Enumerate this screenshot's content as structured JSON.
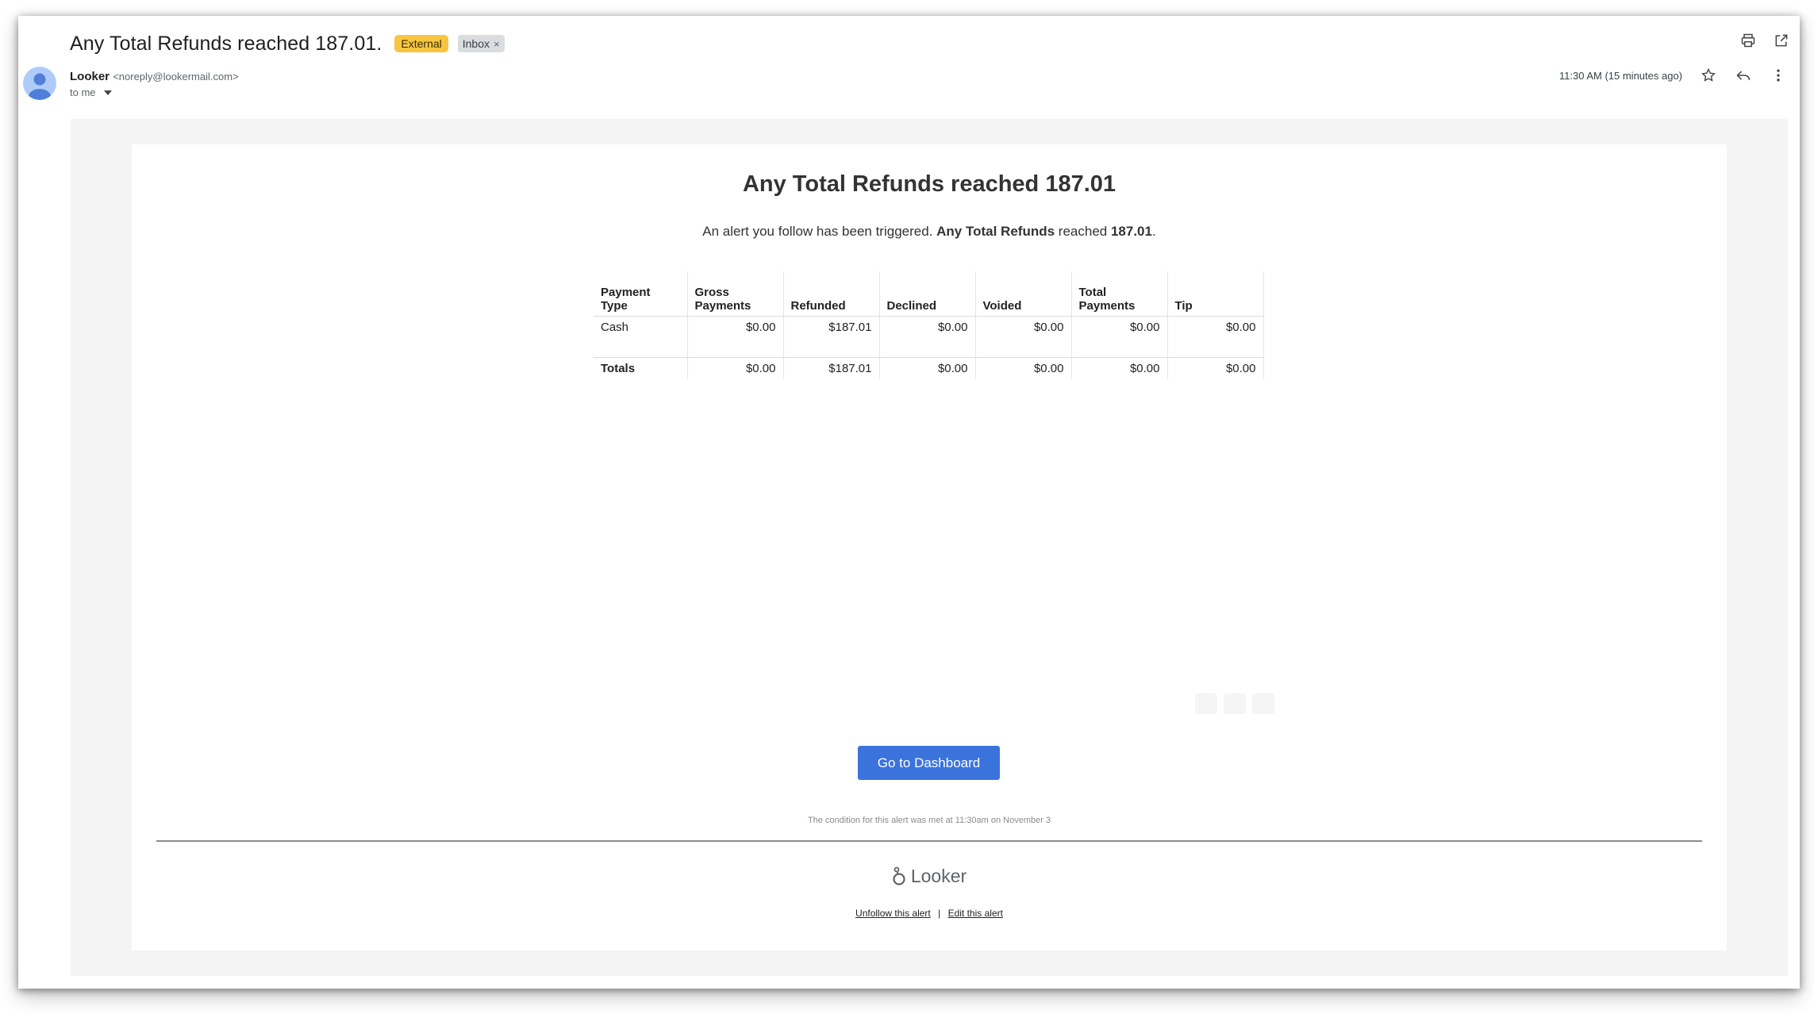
{
  "header": {
    "subject": "Any Total Refunds reached 187.01.",
    "labels": {
      "external": "External",
      "inbox": "Inbox",
      "remove": "×"
    }
  },
  "sender": {
    "name": "Looker",
    "email": "<noreply@lookermail.com>",
    "to": "to me",
    "timestamp": "11:30 AM (15 minutes ago)"
  },
  "icons": {
    "top": [
      "print-icon",
      "open-in-new-window-icon"
    ],
    "meta": [
      "star-icon",
      "reply-icon",
      "more-vertical-icon"
    ]
  },
  "email": {
    "title": "Any Total Refunds reached 187.01",
    "intro_prefix": "An alert you follow has been triggered.",
    "intro_metric": "Any Total Refunds",
    "intro_mid": "reached",
    "intro_value": "187.01",
    "intro_end": ".",
    "table": {
      "headers": [
        "Payment Type",
        "Gross Payments",
        "Refunded",
        "Declined",
        "Voided",
        "Total Payments",
        "Tip"
      ],
      "rows": [
        [
          "Cash",
          "$0.00",
          "$187.01",
          "$0.00",
          "$0.00",
          "$0.00",
          "$0.00"
        ]
      ],
      "totals": [
        "Totals",
        "$0.00",
        "$187.01",
        "$0.00",
        "$0.00",
        "$0.00",
        "$0.00"
      ]
    },
    "cta_label": "Go to Dashboard",
    "condition": "The condition for this alert was met at 11:30am on November 3",
    "brand": "Looker",
    "links": {
      "unfollow": "Unfollow this alert",
      "separator": "|",
      "edit": "Edit this alert"
    }
  }
}
